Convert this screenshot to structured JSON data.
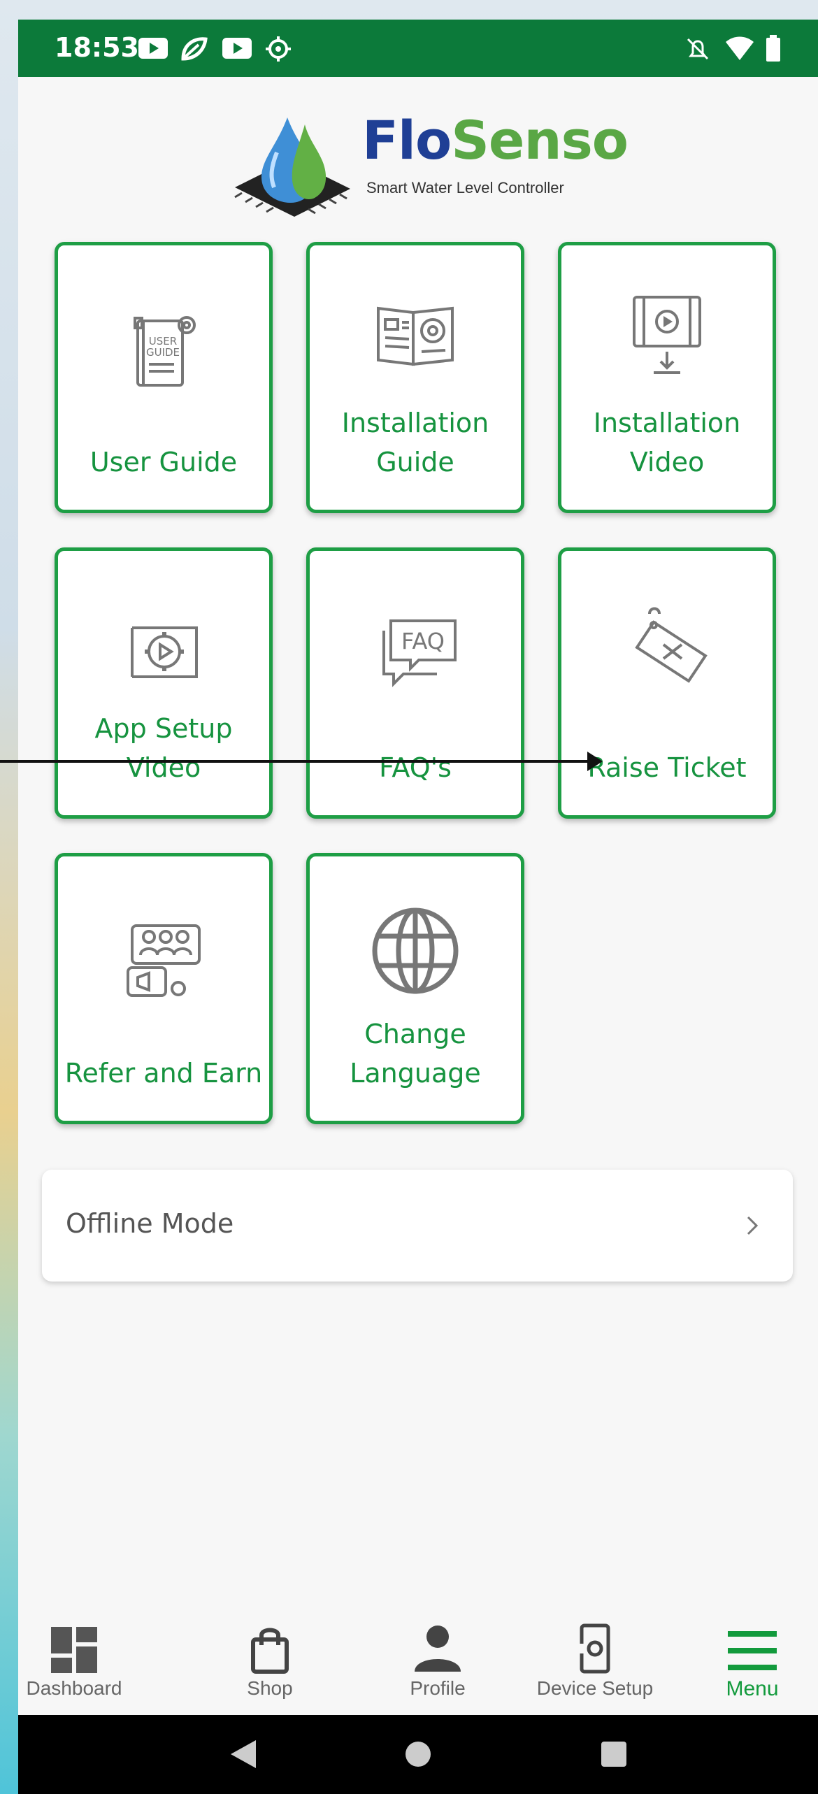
{
  "status_bar": {
    "time": "18:53",
    "left_icons": [
      "youtube-icon",
      "leaf-app-icon",
      "youtube-icon",
      "settings-icon"
    ],
    "right_icons": [
      "notifications-off-icon",
      "wifi-icon",
      "battery-icon"
    ],
    "color": "#0c7a3a"
  },
  "brand": {
    "name_part1": "Flo",
    "name_part2": "Senso",
    "tagline": "Smart Water Level Controller",
    "colors": {
      "primary": "#1f3f95",
      "secondary": "#5aa745"
    }
  },
  "menu_tiles": [
    {
      "label": "User Guide",
      "icon": "user-guide-book-icon"
    },
    {
      "label": "Installation Guide",
      "icon": "installation-guide-icon"
    },
    {
      "label": "Installation Video",
      "icon": "video-download-icon"
    },
    {
      "label": "App Setup Video",
      "icon": "app-setup-video-icon"
    },
    {
      "label": "FAQ's",
      "icon": "faq-icon"
    },
    {
      "label": "Raise Ticket",
      "icon": "ticket-tag-icon"
    },
    {
      "label": "Refer and Earn",
      "icon": "refer-earn-icon"
    },
    {
      "label": "Change Language",
      "icon": "globe-icon"
    }
  ],
  "offline_mode": {
    "label": "Offline Mode",
    "icon": "chevron-right-icon"
  },
  "bottom_nav": {
    "items": [
      {
        "label": "Dashboard",
        "icon": "dashboard-icon"
      },
      {
        "label": "Shop",
        "icon": "shopping-bag-icon"
      },
      {
        "label": "Profile",
        "icon": "person-icon"
      },
      {
        "label": "Device Setup",
        "icon": "device-setup-icon"
      },
      {
        "label": "Menu",
        "icon": "hamburger-menu-icon"
      }
    ],
    "active": "Menu",
    "accent_color": "#129a3c"
  },
  "accent_color": "#1e9e45"
}
